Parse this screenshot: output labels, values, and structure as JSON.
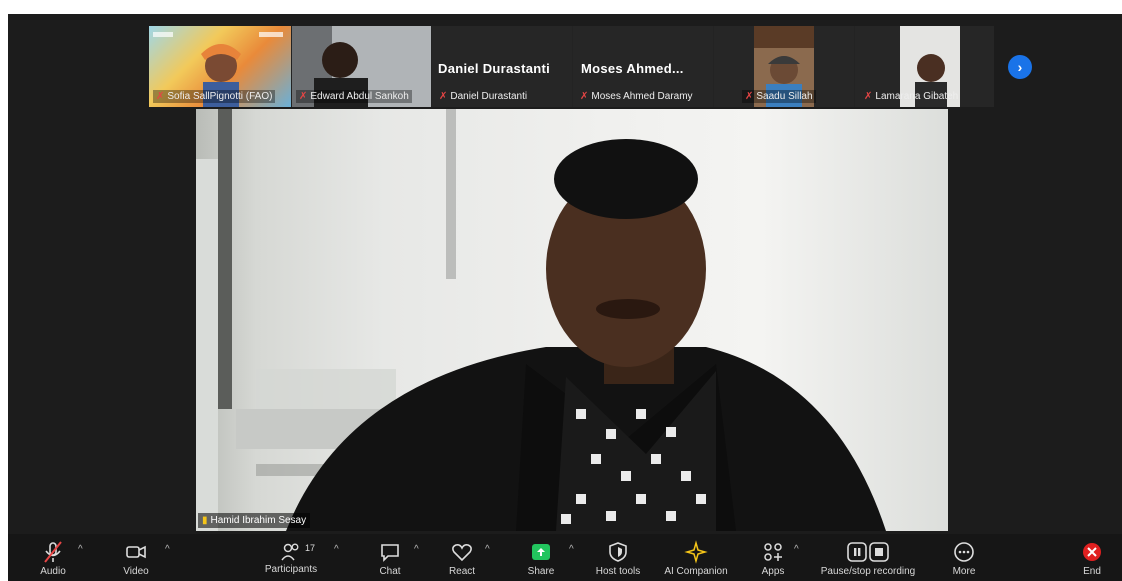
{
  "thumbnails": [
    {
      "name": "Sofia SallPignotti (FAO)"
    },
    {
      "name": "Edward Abdul Sankoh"
    },
    {
      "name": "Daniel Durastanti",
      "big_name": "Daniel Durastanti"
    },
    {
      "name": "Moses Ahmed Daramy",
      "big_name": "Moses  Ahmed..."
    },
    {
      "name": "Saadu Sillah"
    },
    {
      "name": "Lamarana Gibateh"
    }
  ],
  "main_video": {
    "speaker_name": "Hamid Ibrahim Sesay"
  },
  "toolbar": {
    "audio": "Audio",
    "video": "Video",
    "participants": "Participants",
    "participants_count": "17",
    "chat": "Chat",
    "react": "React",
    "share": "Share",
    "host_tools": "Host tools",
    "ai_companion": "AI Companion",
    "apps": "Apps",
    "recording": "Pause/stop recording",
    "more": "More",
    "end": "End"
  },
  "colors": {
    "accent_blue": "#1a73e8",
    "share_green": "#22c55e",
    "end_red": "#e02020",
    "muted_red": "#e64545"
  }
}
